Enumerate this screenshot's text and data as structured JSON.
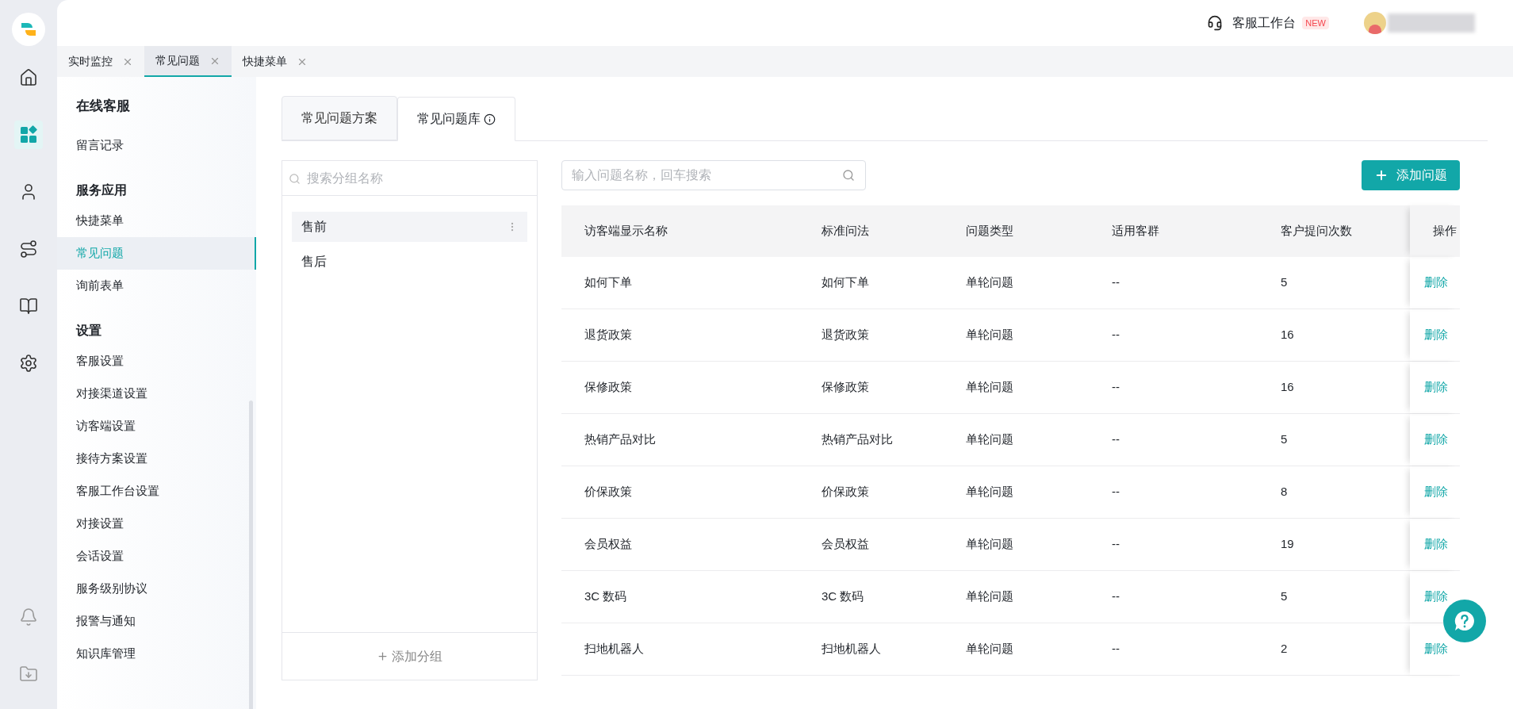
{
  "top_bar": {
    "workbench_label": "客服工作台",
    "workbench_badge": "NEW"
  },
  "nav_rail": [
    {
      "kind": "home",
      "selected": false
    },
    {
      "kind": "apps",
      "selected": true
    },
    {
      "kind": "agent",
      "selected": false
    },
    {
      "kind": "route",
      "selected": false
    },
    {
      "kind": "book",
      "selected": false
    },
    {
      "kind": "settings",
      "selected": false
    }
  ],
  "nav_rail_bottom": [
    {
      "kind": "bell"
    },
    {
      "kind": "download"
    }
  ],
  "page_tabs": [
    {
      "label": "实时监控",
      "selected": false
    },
    {
      "label": "常见问题",
      "selected": true
    },
    {
      "label": "快捷菜单",
      "selected": false
    }
  ],
  "sidebar": {
    "title": "在线客服",
    "sections": [
      {
        "items": [
          {
            "label": "留言记录",
            "selected": false
          }
        ]
      },
      {
        "heading": "服务应用",
        "items": [
          {
            "label": "快捷菜单",
            "selected": false
          },
          {
            "label": "常见问题",
            "selected": true
          },
          {
            "label": "询前表单",
            "selected": false
          }
        ]
      },
      {
        "heading": "设置",
        "items": [
          {
            "label": "客服设置",
            "selected": false
          },
          {
            "label": "对接渠道设置",
            "selected": false
          },
          {
            "label": "访客端设置",
            "selected": false
          },
          {
            "label": "接待方案设置",
            "selected": false
          },
          {
            "label": "客服工作台设置",
            "selected": false
          },
          {
            "label": "对接设置",
            "selected": false
          },
          {
            "label": "会话设置",
            "selected": false
          },
          {
            "label": "服务级别协议",
            "selected": false
          },
          {
            "label": "报警与通知",
            "selected": false
          },
          {
            "label": "知识库管理",
            "selected": false
          }
        ]
      }
    ]
  },
  "content_tabs": [
    {
      "label": "常见问题方案",
      "selected": false,
      "info": false
    },
    {
      "label": "常见问题库",
      "selected": true,
      "info": true
    }
  ],
  "group_panel": {
    "search_placeholder": "搜索分组名称",
    "groups": [
      {
        "label": "售前",
        "selected": true
      },
      {
        "label": "售后",
        "selected": false
      }
    ],
    "add_label": "添加分组"
  },
  "question_search": {
    "placeholder": "输入问题名称，回车搜索"
  },
  "add_question_label": "添加问题",
  "table": {
    "columns": [
      "访客端显示名称",
      "标准问法",
      "问题类型",
      "适用客群",
      "客户提问次数",
      "操作"
    ],
    "rows": [
      {
        "cells": [
          "如何下单",
          "如何下单",
          "单轮问题",
          "--",
          "5"
        ],
        "action": "删除"
      },
      {
        "cells": [
          "退货政策",
          "退货政策",
          "单轮问题",
          "--",
          "16"
        ],
        "action": "删除"
      },
      {
        "cells": [
          "保修政策",
          "保修政策",
          "单轮问题",
          "--",
          "16"
        ],
        "action": "删除"
      },
      {
        "cells": [
          "热销产品对比",
          "热销产品对比",
          "单轮问题",
          "--",
          "5"
        ],
        "action": "删除"
      },
      {
        "cells": [
          "价保政策",
          "价保政策",
          "单轮问题",
          "--",
          "8"
        ],
        "action": "删除"
      },
      {
        "cells": [
          "会员权益",
          "会员权益",
          "单轮问题",
          "--",
          "19"
        ],
        "action": "删除"
      },
      {
        "cells": [
          "3C 数码",
          "3C 数码",
          "单轮问题",
          "--",
          "5"
        ],
        "action": "删除"
      },
      {
        "cells": [
          "扫地机器人",
          "扫地机器人",
          "单轮问题",
          "--",
          "2"
        ],
        "action": "删除"
      }
    ]
  }
}
